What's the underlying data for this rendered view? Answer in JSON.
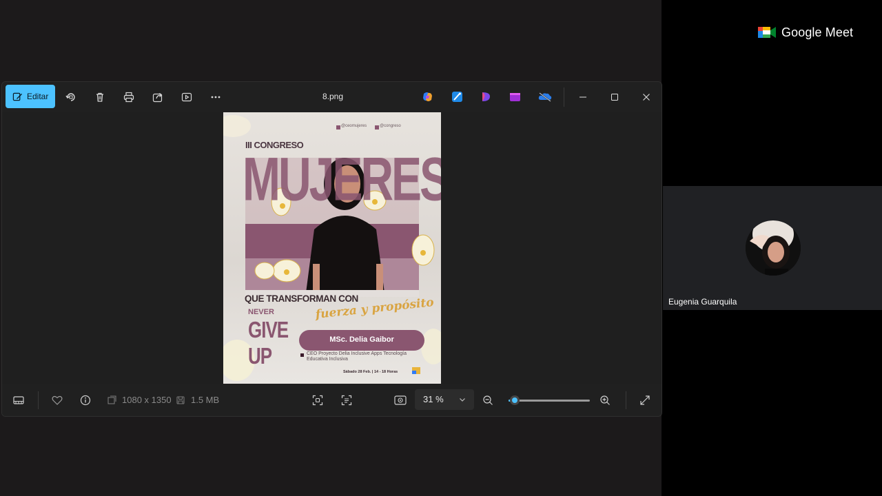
{
  "meet": {
    "brand_label": "Google Meet",
    "participant_name": "Eugenia Guarquila"
  },
  "photos_window": {
    "toolbar": {
      "edit_label": "Editar",
      "file_name": "8.png",
      "icons": [
        "rotate-icon",
        "delete-icon",
        "print-icon",
        "share-icon",
        "slideshow-icon",
        "more-icon"
      ],
      "app_icons": [
        "copilot-icon",
        "designer-icon",
        "clipchamp-icon",
        "photos-app-icon",
        "onedrive-icon"
      ]
    },
    "poster": {
      "handle_1": "@ceomujeres",
      "handle_2": "@congreso",
      "kicker": "III CONGRESO",
      "headline": "MUJERES",
      "subline": "QUE TRANSFORMAN CON",
      "script_line": "fuerza y propósito",
      "side_top": "NEVER",
      "side_mid": "GIVE",
      "side_bottom": "UP",
      "speaker": "MSc. Delia Gaibor",
      "role": "CEO Proyecto Delia Inclusive Apps Tecnología Educativa Inclusiva",
      "date_line": "Sábado 28 Feb. | 14 - 18 Horas"
    },
    "bottombar": {
      "dimensions": "1080 x 1350",
      "file_size": "1.5 MB",
      "zoom_label": "31 %",
      "zoom_fraction": 0.08
    }
  },
  "colors": {
    "accent": "#4cc2ff",
    "poster_mauve": "#8a5670",
    "poster_gold": "#d9a441"
  }
}
